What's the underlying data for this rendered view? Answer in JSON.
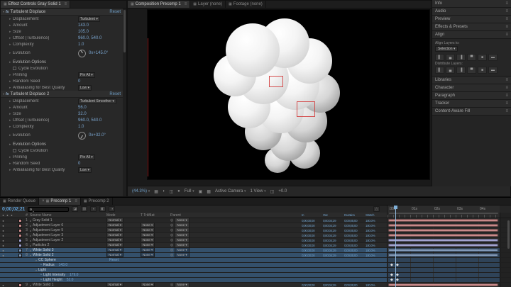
{
  "effect_controls": {
    "tab": "Effect Controls Gray Solid 1",
    "effects": [
      {
        "name": "Turbulent Displace",
        "reset": "Reset",
        "rows": [
          {
            "t": "dropdown",
            "label": "Displacement",
            "value": "Turbulent"
          },
          {
            "t": "num",
            "label": "Amount",
            "value": "143.0"
          },
          {
            "t": "num",
            "label": "Size",
            "value": "105.0"
          },
          {
            "t": "num",
            "label": "Offset (Turbulence)",
            "value": "960.0, 540.0"
          },
          {
            "t": "num",
            "label": "Complexity",
            "value": "1.0"
          },
          {
            "t": "dial",
            "label": "Evolution",
            "value": "0x+145.0°",
            "angle": 145
          },
          {
            "t": "group",
            "label": "Evolution Options"
          },
          {
            "t": "check",
            "label": "Cycle Evolution"
          },
          {
            "t": "dropdown",
            "label": "Pinning",
            "value": "Pin All"
          },
          {
            "t": "num",
            "label": "Random Seed",
            "value": "0"
          },
          {
            "t": "dropdown",
            "label": "Antialiasing for Best Quality",
            "value": "Low"
          }
        ]
      },
      {
        "name": "Turbulent Displace 2",
        "reset": "Reset",
        "rows": [
          {
            "t": "dropdown",
            "label": "Displacement",
            "value": "Turbulent Smoother"
          },
          {
            "t": "num",
            "label": "Amount",
            "value": "56.0"
          },
          {
            "t": "num",
            "label": "Size",
            "value": "32.0"
          },
          {
            "t": "num",
            "label": "Offset (Turbulence)",
            "value": "960.0, 540.0"
          },
          {
            "t": "num",
            "label": "Complexity",
            "value": "1.0"
          },
          {
            "t": "dial",
            "label": "Evolution",
            "value": "0x+32.0°",
            "angle": 32
          },
          {
            "t": "group",
            "label": "Evolution Options"
          },
          {
            "t": "check",
            "label": "Cycle Evolution"
          },
          {
            "t": "dropdown",
            "label": "Pinning",
            "value": "Pin All"
          },
          {
            "t": "num",
            "label": "Random Seed",
            "value": "0"
          },
          {
            "t": "dropdown",
            "label": "Antialiasing for Best Quality",
            "value": "Low"
          }
        ]
      }
    ]
  },
  "composition": {
    "tabs": [
      {
        "label": "Composition Precomp 1",
        "active": true
      },
      {
        "label": "Layer (none)",
        "active": false
      },
      {
        "label": "Footage (none)",
        "active": false
      }
    ],
    "toolbar": {
      "zoom": "(44.3%)",
      "resolution": "Full",
      "camera": "Active Camera",
      "view_layout": "1 View",
      "exposure": "+0.0"
    }
  },
  "sidebar": {
    "panels": [
      "Info",
      "Audio",
      "Preview",
      "Effects & Presets",
      "Align",
      "Libraries",
      "Character",
      "Paragraph",
      "Tracker",
      "Content-Aware Fill"
    ],
    "align": {
      "layers_label": "Align Layers to:",
      "selection": "Selection",
      "distribute_label": "Distribute Layers:"
    }
  },
  "timeline": {
    "tabs": [
      {
        "label": "Render Queue",
        "active": false
      },
      {
        "label": "Precomp 1",
        "active": true
      },
      {
        "label": "Precomp 2",
        "active": false
      }
    ],
    "timecode": "0;00;02;21",
    "columns": {
      "num": "#",
      "source": "Source Name",
      "mode": "Mode",
      "trkmat": "T TrkMat",
      "parent": "Parent",
      "tin": "In",
      "tout": "Out",
      "duration": "Duration",
      "stretch": "Stretch"
    },
    "ruler": [
      ":00s",
      "01s",
      "02s",
      "03s",
      "04s"
    ],
    "colors": {
      "salmon": "#c98a8a",
      "lavender": "#a2a2cf",
      "steel": "#8098b8",
      "selected_row": "#34506b",
      "accent_blue": "#6f9fc8"
    },
    "rows": [
      {
        "k": "layer",
        "num": "1",
        "name": "Gray Solid 1",
        "mode": "Normal",
        "trkmat": "",
        "parent": "None",
        "tin": "0;00;00;00",
        "tout": "0;00;04;29",
        "dur": "0;00;05;00",
        "stretch": "100.0%",
        "bar": "#c98a8a",
        "sel": false,
        "exp": false
      },
      {
        "k": "layer",
        "num": "2",
        "name": "Adjustment Layer 6",
        "mode": "Normal",
        "trkmat": "None",
        "parent": "None",
        "tin": "0;00;00;00",
        "tout": "0;00;04;29",
        "dur": "0;00;05;00",
        "stretch": "100.0%",
        "bar": "#c98a8a",
        "sel": false,
        "exp": false
      },
      {
        "k": "layer",
        "num": "3",
        "name": "Adjustment Layer 5",
        "mode": "Normal",
        "trkmat": "None",
        "parent": "None",
        "tin": "0;00;00;00",
        "tout": "0;00;04;29",
        "dur": "0;00;05;00",
        "stretch": "100.0%",
        "bar": "#c98a8a",
        "sel": false,
        "exp": false
      },
      {
        "k": "layer",
        "num": "4",
        "name": "Adjustment Layer 3",
        "mode": "Normal",
        "trkmat": "None",
        "parent": "None",
        "tin": "0;00;00;00",
        "tout": "0;00;04;29",
        "dur": "0;00;05;00",
        "stretch": "100.0%",
        "bar": "#c98a8a",
        "sel": false,
        "exp": false
      },
      {
        "k": "layer",
        "num": "5",
        "name": "Adjustment Layer 2",
        "mode": "Normal",
        "trkmat": "None",
        "parent": "None",
        "tin": "0;00;00;00",
        "tout": "0;00;04;29",
        "dur": "0;00;05;00",
        "stretch": "100.0%",
        "bar": "#a2a2cf",
        "sel": false,
        "exp": false
      },
      {
        "k": "layer",
        "num": "6",
        "name": "Particles 2",
        "mode": "Normal",
        "trkmat": "None",
        "parent": "None",
        "tin": "0;00;00;00",
        "tout": "0;00;04;29",
        "dur": "0;00;05;00",
        "stretch": "100.0%",
        "bar": "#a2a2cf",
        "sel": false,
        "exp": false
      },
      {
        "k": "layer",
        "num": "7",
        "name": "White Solid 3",
        "mode": "Normal",
        "trkmat": "None",
        "parent": "None",
        "tin": "0;00;00;00",
        "tout": "0;00;04;29",
        "dur": "0;00;05;00",
        "stretch": "100.0%",
        "bar": "#8098b8",
        "sel": true,
        "exp": false
      },
      {
        "k": "layer",
        "num": "8",
        "name": "White Solid 2",
        "mode": "Normal",
        "trkmat": "None",
        "parent": "None",
        "tin": "0;00;00;00",
        "tout": "0;00;04;29",
        "dur": "0;00;05;00",
        "stretch": "100.0%",
        "bar": "#8098b8",
        "sel": true,
        "exp": true
      },
      {
        "k": "group",
        "label": "CC Sphere",
        "value": "Reset",
        "sel": true
      },
      {
        "k": "prop",
        "label": "Radius",
        "value": "143.0",
        "sel": true
      },
      {
        "k": "group",
        "label": "Light",
        "value": "",
        "sel": true
      },
      {
        "k": "prop",
        "label": "Light Intensity",
        "value": "179.0",
        "sel": true
      },
      {
        "k": "prop",
        "label": "Light Height",
        "value": "52.0",
        "sel": true
      },
      {
        "k": "layer",
        "num": "9",
        "name": "White Solid 1",
        "mode": "Normal",
        "trkmat": "None",
        "parent": "None",
        "tin": "0;00;00;00",
        "tout": "0;00;04;29",
        "dur": "0;00;05;00",
        "stretch": "100.0%",
        "bar": "#c98a8a",
        "sel": false,
        "exp": false
      }
    ]
  }
}
